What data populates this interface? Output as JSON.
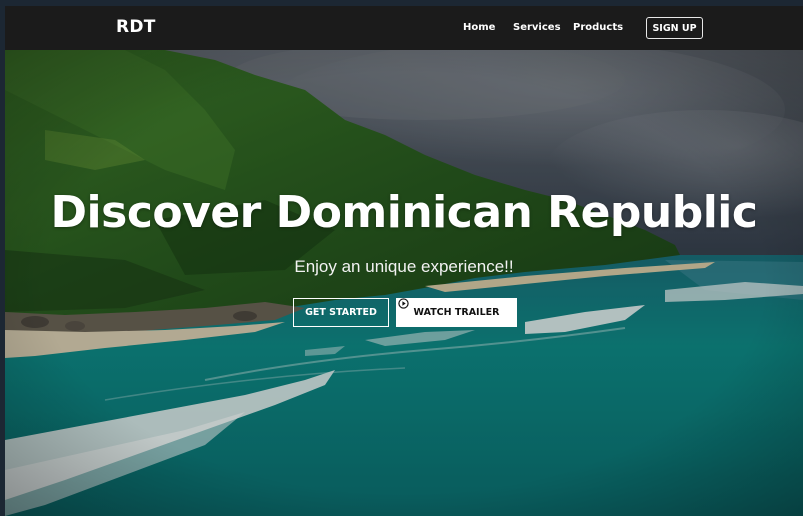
{
  "navbar": {
    "logo": "RDT",
    "links": [
      {
        "label": "Home"
      },
      {
        "label": "Services"
      },
      {
        "label": "Products"
      }
    ],
    "signup_label": "SIGN UP"
  },
  "hero": {
    "title": "Discover Dominican Republic",
    "subtitle": "Enjoy an unique experience!!",
    "primary_button": "GET STARTED",
    "secondary_button": "WATCH TRAILER",
    "secondary_button_icon": "play-circle-icon",
    "background_scene": "coastal-cliff-aerial"
  },
  "colors": {
    "navbar_bg": "#1b1b1b",
    "text": "#ffffff",
    "sea": "#0f8f8c",
    "forest": "#2f6a24",
    "sky": "#5e6670"
  }
}
